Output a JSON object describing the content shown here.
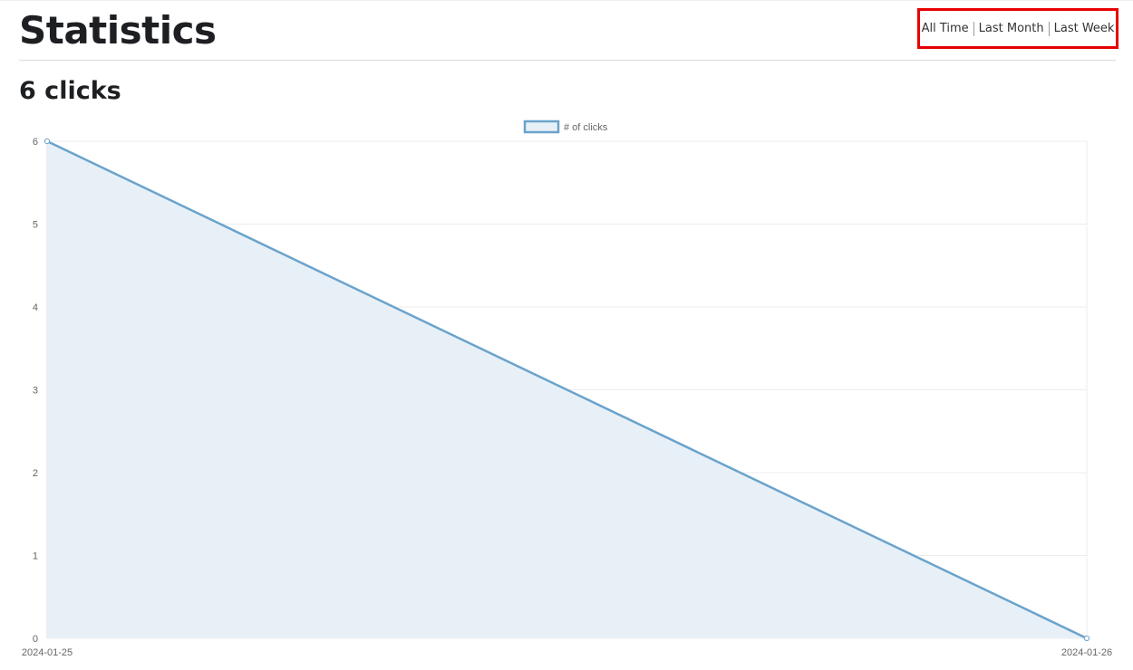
{
  "page": {
    "title": "Statistics",
    "clicks_heading": "6 clicks"
  },
  "range_selector": {
    "options": [
      {
        "label": "All Time"
      },
      {
        "label": "Last Month"
      },
      {
        "label": "Last Week"
      }
    ]
  },
  "colors": {
    "highlight_border": "#e60000",
    "series_line": "#6aa3cc",
    "series_fill": "#e8f0f7",
    "grid": "#ececec",
    "tick_text": "#666666"
  },
  "chart_data": {
    "type": "line",
    "title": "",
    "xlabel": "",
    "ylabel": "",
    "legend": "top-center",
    "grid": true,
    "fill": true,
    "x": [
      "2024-01-25",
      "2024-01-26"
    ],
    "series": [
      {
        "name": "# of clicks",
        "values": [
          6,
          0
        ]
      }
    ],
    "ylim": [
      0,
      6
    ],
    "yticks": [
      0,
      1,
      2,
      3,
      4,
      5,
      6
    ]
  }
}
